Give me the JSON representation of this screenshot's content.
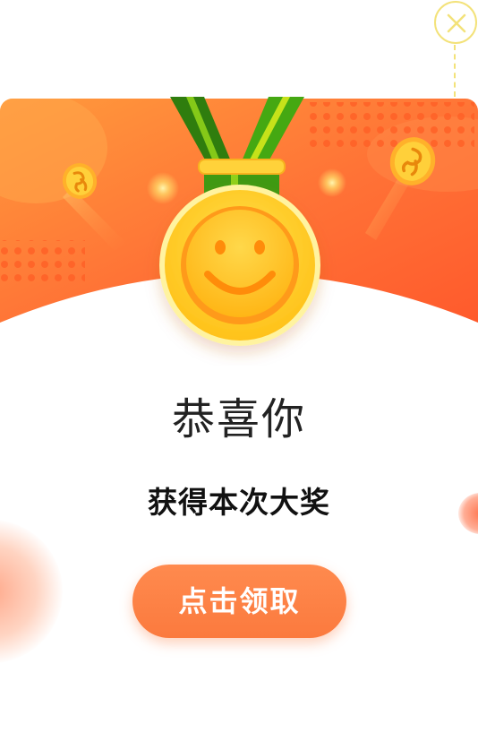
{
  "dialog": {
    "title": "恭喜你",
    "subtitle": "获得本次大奖",
    "claim_label": "点击领取",
    "close_icon": "close-icon",
    "medal_icon": "smiley-medal-icon"
  },
  "colors": {
    "banner_start": "#ff9a3c",
    "banner_end": "#ff5a2c",
    "button": "#fb7a3e",
    "medal_gold": "#ffd23a",
    "ribbon_green": "#3f9a12",
    "close_stroke": "#f3e27a"
  }
}
